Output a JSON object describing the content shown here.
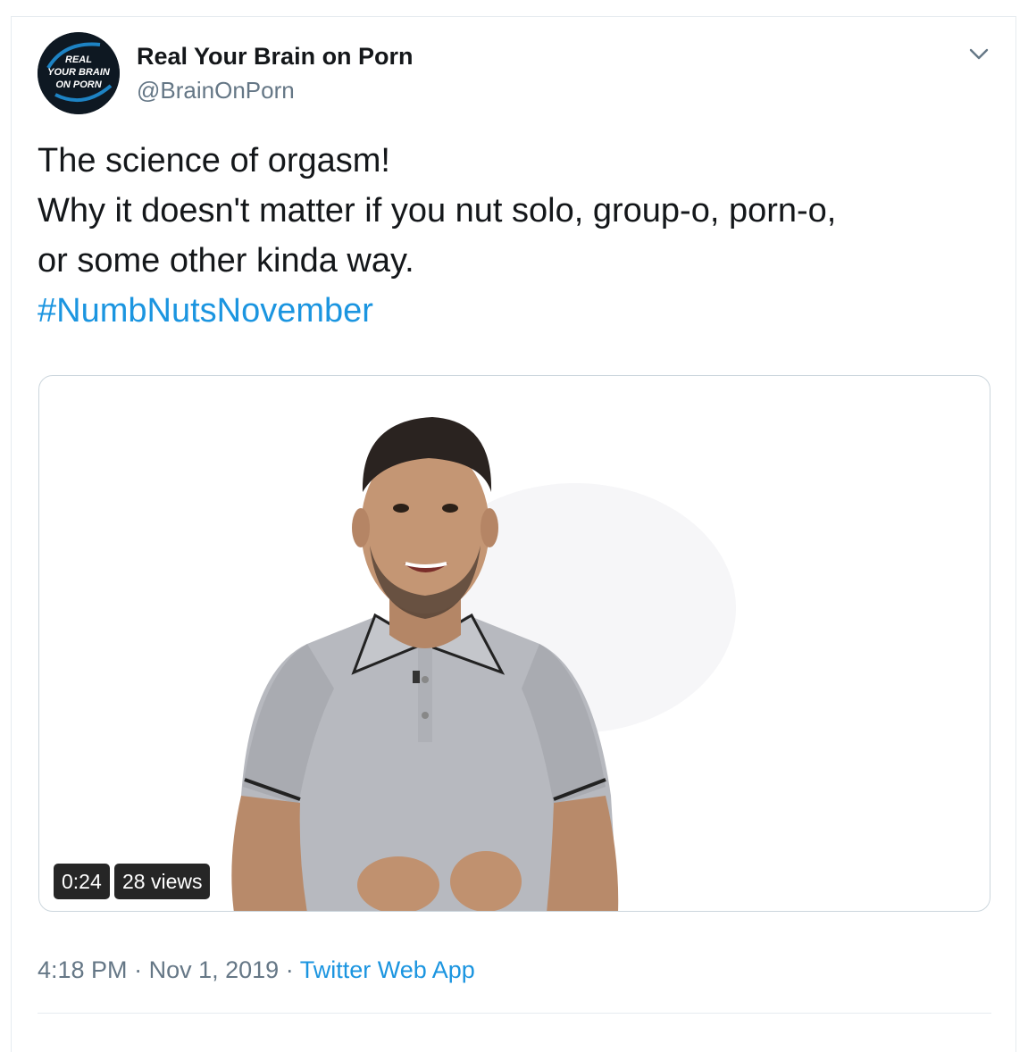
{
  "tweet": {
    "author": {
      "display_name": "Real Your Brain on Porn",
      "handle": "@BrainOnPorn",
      "avatar_text": [
        "REAL",
        "YOUR BRAIN",
        "ON PORN"
      ]
    },
    "text_lines": [
      "The science of orgasm!",
      "Why it doesn't matter if you nut solo, group-o, porn-o,",
      "or some other kinda way."
    ],
    "hashtag": "#NumbNutsNovember",
    "media": {
      "duration": "0:24",
      "views": "28 views"
    },
    "time": "4:18 PM",
    "date": "Nov 1, 2019",
    "separator": "·",
    "source": "Twitter Web App"
  },
  "colors": {
    "link": "#1b95e0",
    "secondary_text": "#657786",
    "border": "#e6ecf0"
  },
  "icons": {
    "menu": "chevron-down-icon"
  }
}
